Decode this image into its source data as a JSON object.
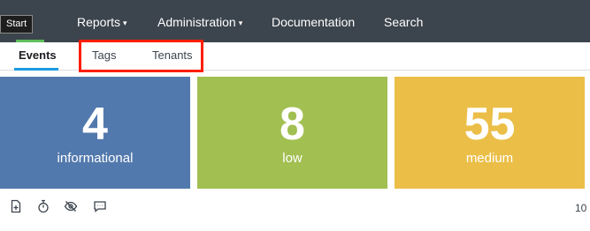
{
  "nav": {
    "start_label": "Start",
    "start_visible": "rt",
    "items": [
      {
        "label": "Reports",
        "has_dropdown": true
      },
      {
        "label": "Administration",
        "has_dropdown": true
      },
      {
        "label": "Documentation"
      },
      {
        "label": "Search"
      }
    ],
    "caret_glyph": "▾"
  },
  "tooltip": {
    "text": "Start"
  },
  "tabs": [
    {
      "label": "Events",
      "active": true
    },
    {
      "label": "Tags"
    },
    {
      "label": "Tenants"
    }
  ],
  "tiles": [
    {
      "value": "4",
      "label": "informational",
      "color": "#5279ad"
    },
    {
      "value": "8",
      "label": "low",
      "color": "#a2bf51"
    },
    {
      "value": "55",
      "label": "medium",
      "color": "#ebbe47"
    }
  ],
  "toolbar": {
    "icons": [
      "add-panel-icon",
      "stopwatch-icon",
      "hide-icon",
      "comment-icon"
    ],
    "count_text": "10"
  },
  "colors": {
    "nav_bg": "#3c444d",
    "accent_blue": "#1a9ae0",
    "start_green": "#5cc05c",
    "highlight_red": "#ff1e00"
  }
}
